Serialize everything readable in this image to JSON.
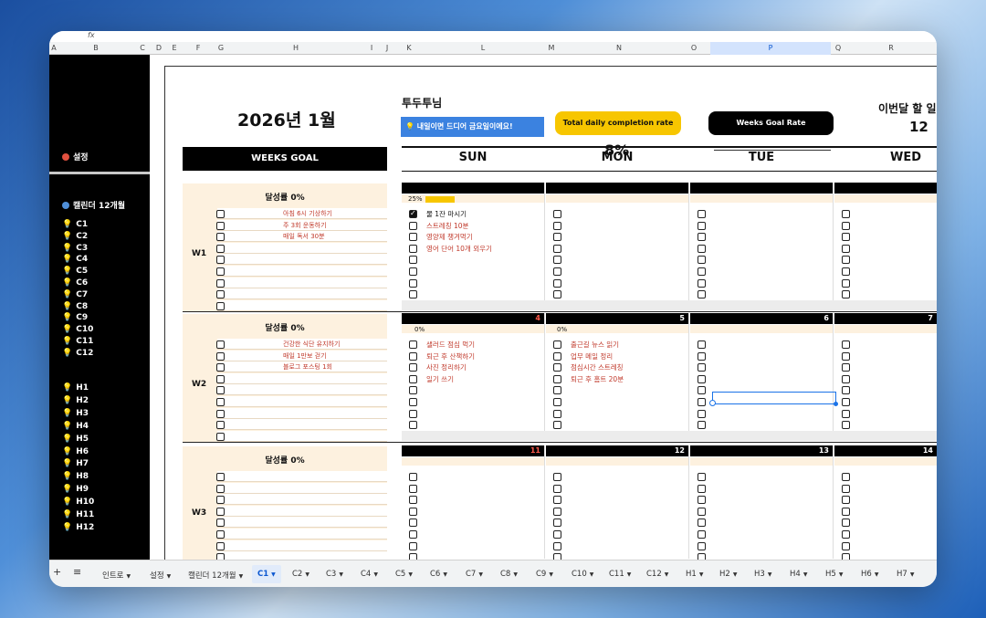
{
  "formula_icon": "fx",
  "columns": [
    "A",
    "B",
    "C",
    "D",
    "E",
    "F",
    "G",
    "H",
    "I",
    "J",
    "K",
    "L",
    "M",
    "N",
    "O",
    "P",
    "Q",
    "R"
  ],
  "selected_column": "P",
  "sidebar": {
    "settings": "설정",
    "calendar": "캘린더 12개월",
    "c_items": [
      "C1",
      "C2",
      "C3",
      "C4",
      "C5",
      "C6",
      "C7",
      "C8",
      "C9",
      "C10",
      "C11",
      "C12"
    ],
    "h_items": [
      "H1",
      "H2",
      "H3",
      "H4",
      "H5",
      "H6",
      "H7",
      "H8",
      "H9",
      "H10",
      "H11",
      "H12"
    ]
  },
  "header": {
    "month_title": "2026년 1월",
    "user_name": "투두투님",
    "notice": "💡 내일이면 드디어 금요일이에요!",
    "daily_rate_label": "Total daily completion rate",
    "daily_rate_value": "8%",
    "weeks_goal_rate_label": "Weeks Goal Rate",
    "month_label": "이번달 할 일",
    "month_count": "12",
    "weeks_goal_header": "WEEKS GOAL",
    "days": [
      "SUN",
      "MON",
      "TUE",
      "WED"
    ]
  },
  "weeks": [
    {
      "label": "W1",
      "rate": "달성률 0%",
      "goals": [
        "아침 6시 기상하기",
        "주 3회 운동하기",
        "매일 독서 30분"
      ],
      "day_numbers": [
        "",
        "",
        "",
        ""
      ],
      "sun_pct": "25%",
      "sun_fill": 0.25,
      "sun_tasks": [
        "물 1잔 마시기",
        "스트레칭 10분",
        "영양제 챙겨먹기",
        "영어 단어 10개 외우기"
      ],
      "mon_pct": "",
      "mon_tasks": []
    },
    {
      "label": "W2",
      "rate": "달성률 0%",
      "goals": [
        "건강한 식단 유지하기",
        "매일 1만보 걷기",
        "블로그 포스팅 1회"
      ],
      "day_numbers": [
        "4",
        "5",
        "6",
        "7"
      ],
      "sun_pct": "0%",
      "sun_tasks": [
        "샐러드 점심 먹기",
        "퇴근 후 산책하기",
        "사진 정리하기",
        "일기 쓰기"
      ],
      "mon_pct": "0%",
      "mon_tasks": [
        "출근길 뉴스 읽기",
        "업무 메일 정리",
        "점심시간 스트레칭",
        "퇴근 후 홈트 20분"
      ]
    },
    {
      "label": "W3",
      "rate": "달성률 0%",
      "goals": [],
      "day_numbers": [
        "11",
        "12",
        "13",
        "14"
      ],
      "sun_pct": "",
      "sun_tasks": [],
      "mon_pct": "",
      "mon_tasks": []
    }
  ],
  "tabs": [
    "인트로",
    "설정",
    "캘린더 12개월",
    "C1",
    "C2",
    "C3",
    "C4",
    "C5",
    "C6",
    "C7",
    "C8",
    "C9",
    "C10",
    "C11",
    "C12",
    "H1",
    "H2",
    "H3",
    "H4",
    "H5",
    "H6",
    "H7"
  ],
  "active_tab": "C1",
  "colors": {
    "accent_yellow": "#f7c600",
    "notice_blue": "#3b82e0",
    "week_bg": "#fdf1df",
    "task_red": "#c0392b"
  }
}
